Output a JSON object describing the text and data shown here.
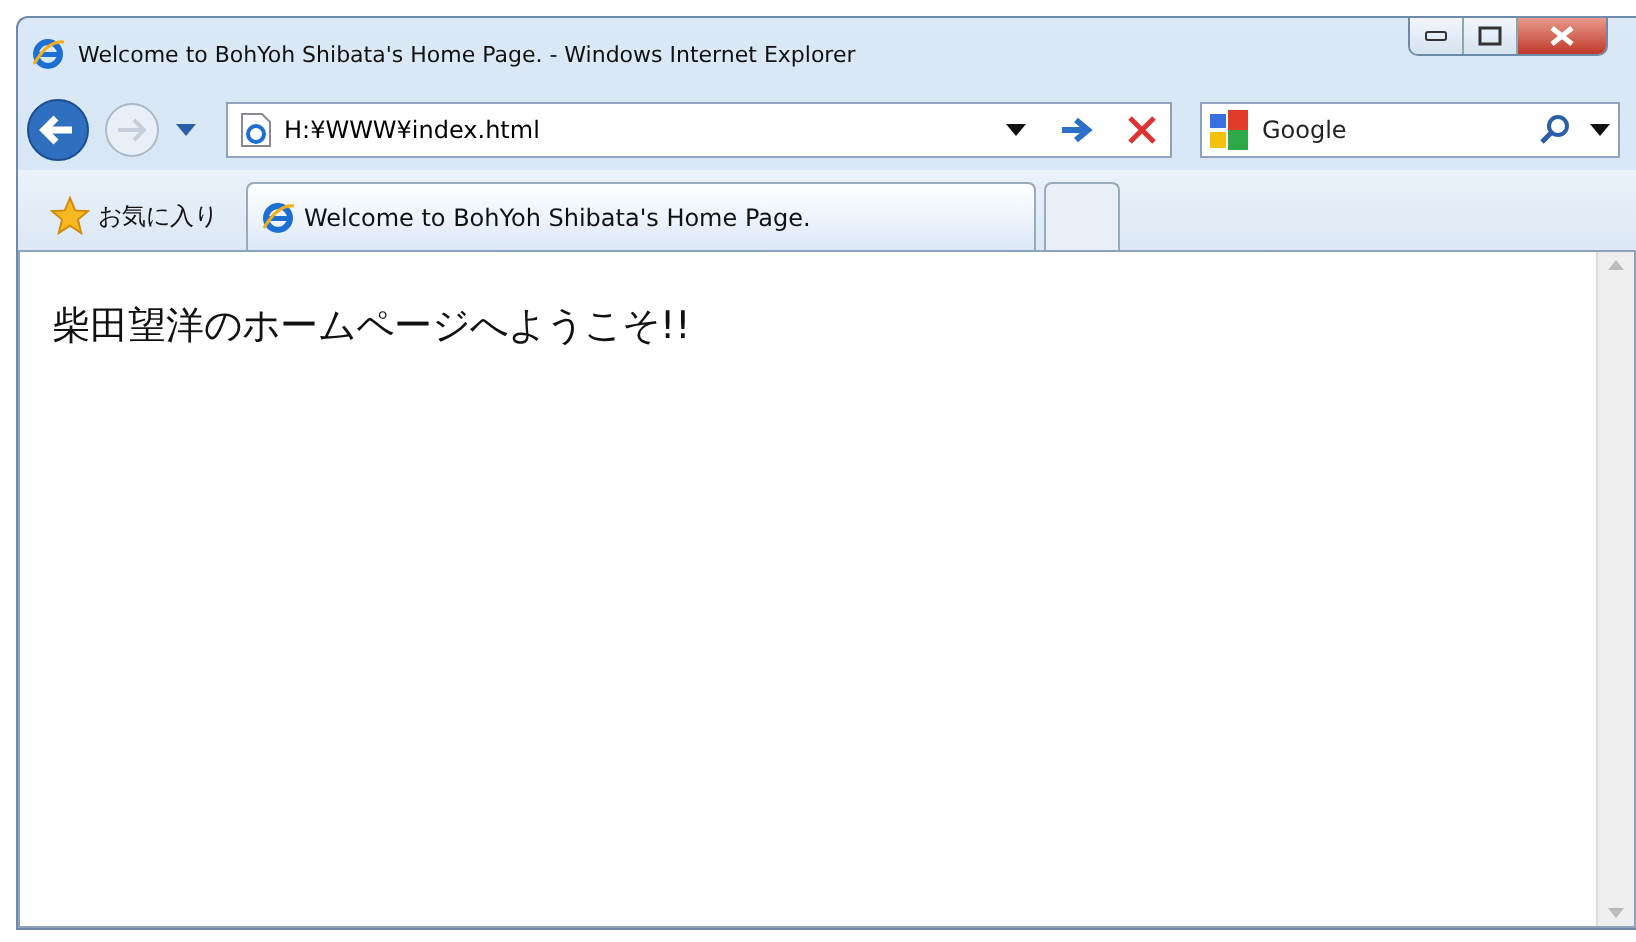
{
  "window": {
    "title": "Welcome to BohYoh Shibata's Home Page. - Windows Internet Explorer"
  },
  "address": {
    "value": "H:¥WWW¥index.html"
  },
  "search": {
    "placeholder": "Google"
  },
  "favorites": {
    "label": "お気に入り"
  },
  "tabs": [
    {
      "label": "Welcome to BohYoh Shibata's Home Page.",
      "selected": true
    }
  ],
  "page": {
    "heading": "柴田望洋のホームページへようこそ!!"
  }
}
